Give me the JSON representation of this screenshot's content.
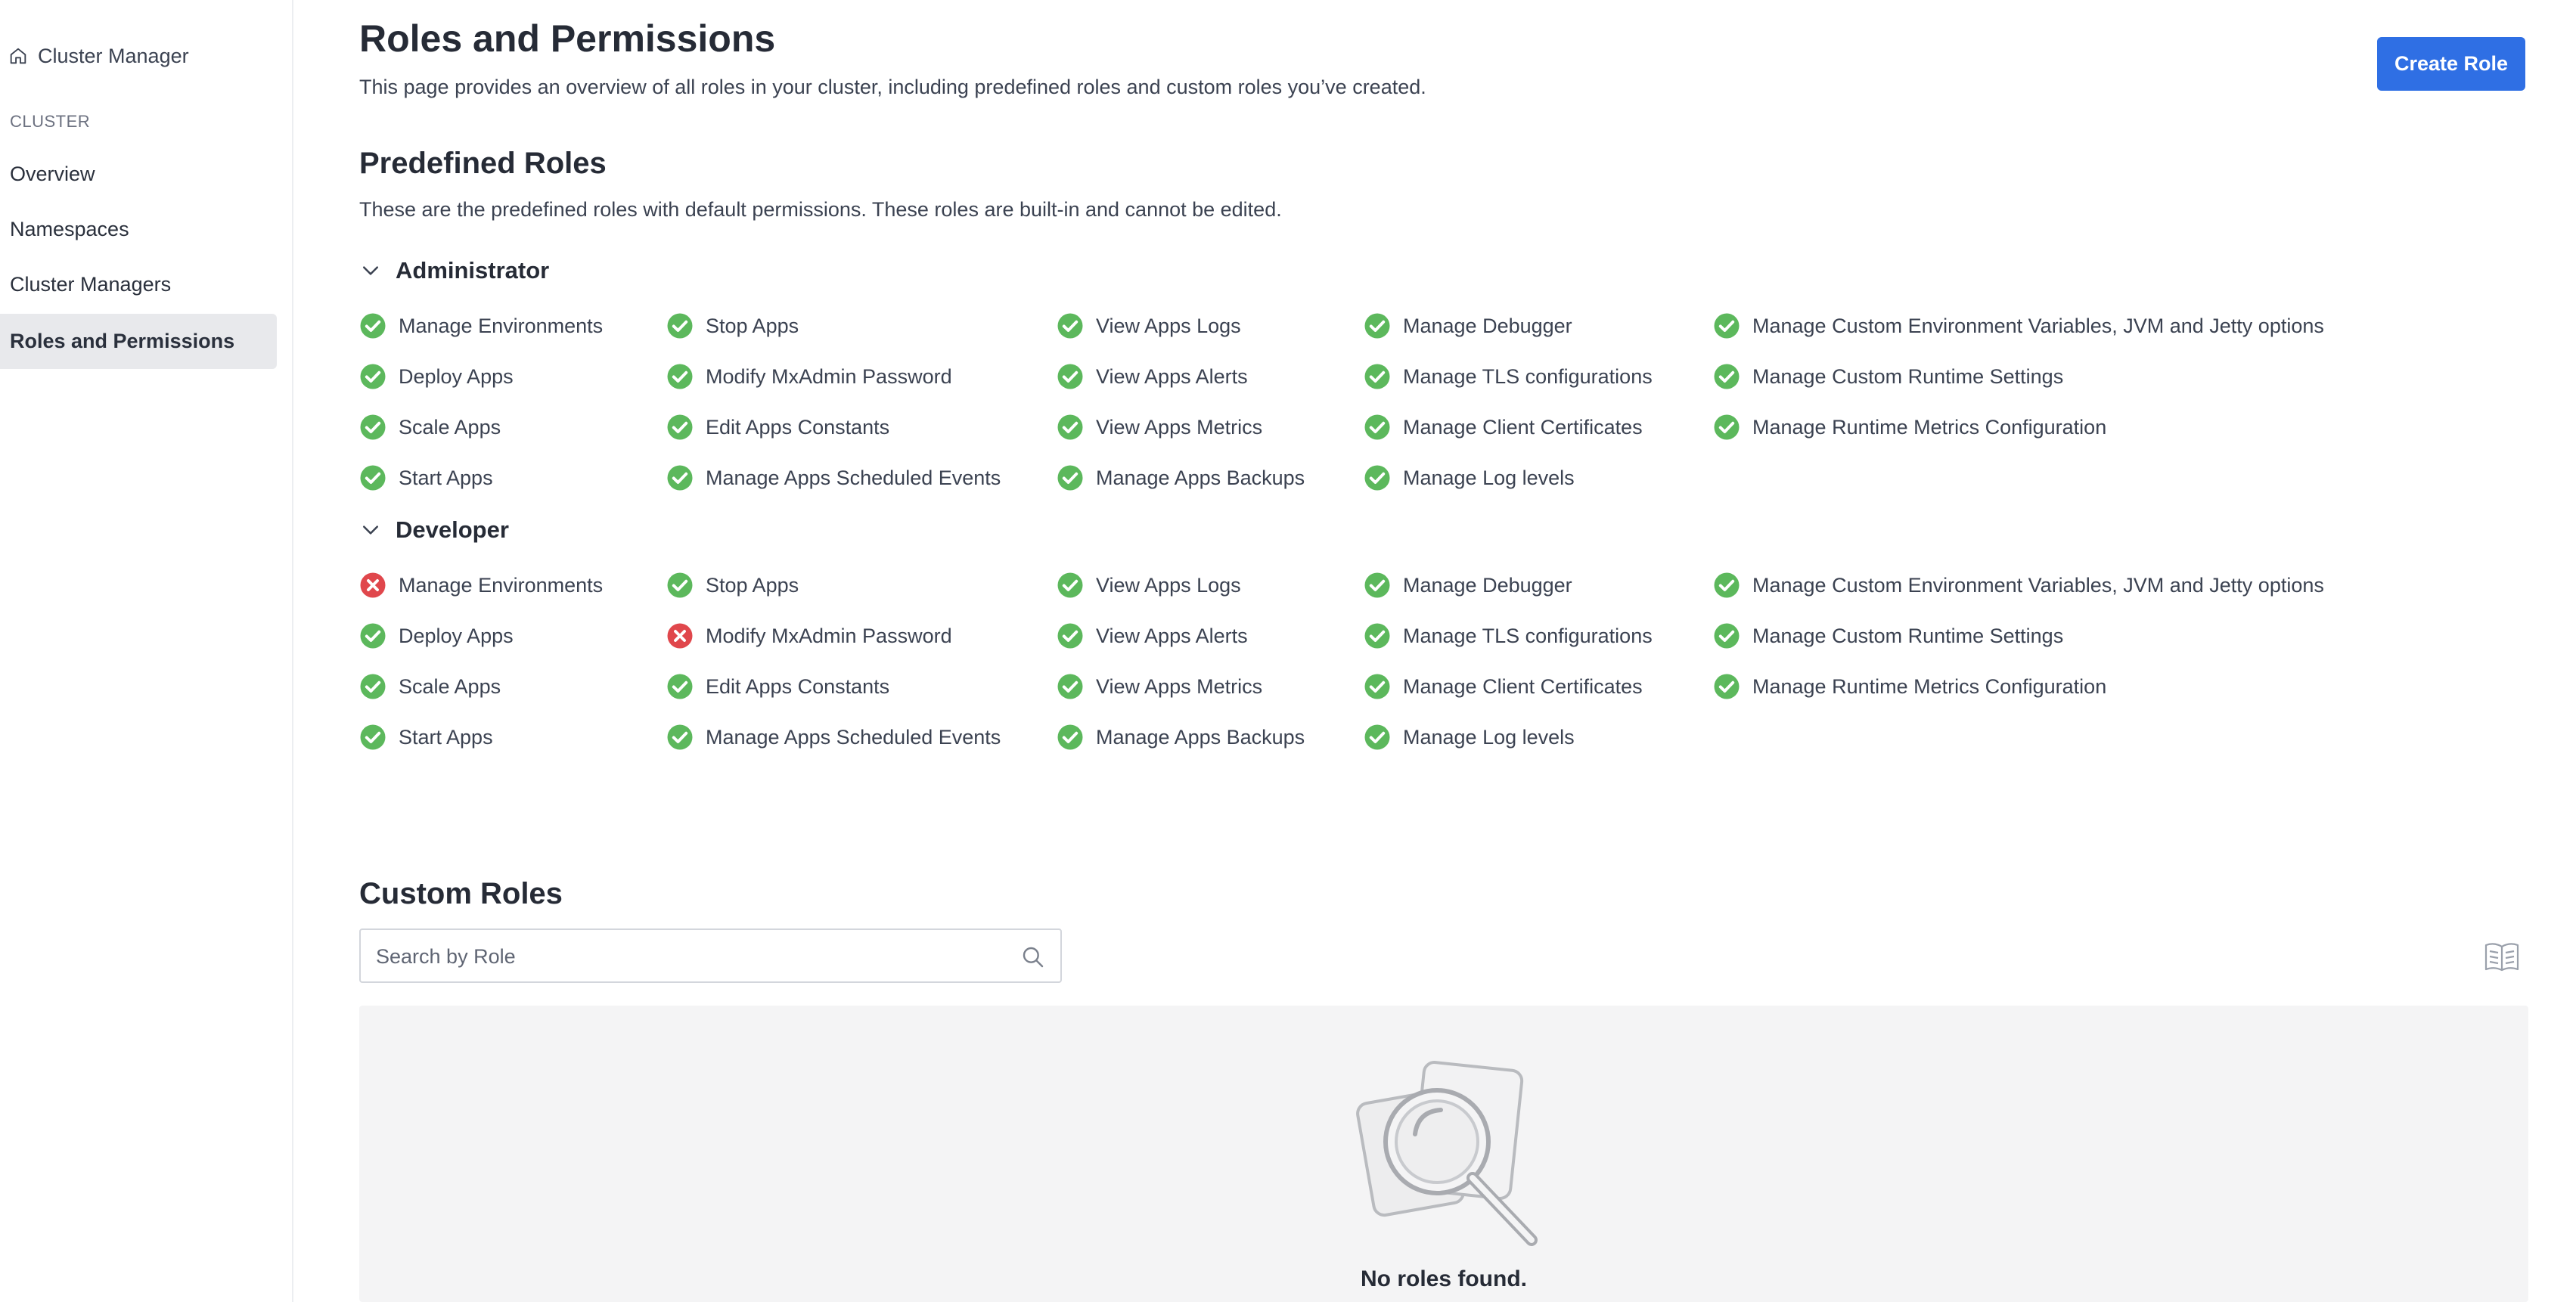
{
  "sidebar": {
    "brand": "Cluster Manager",
    "section_label": "CLUSTER",
    "items": [
      {
        "label": "Overview"
      },
      {
        "label": "Namespaces"
      },
      {
        "label": "Cluster Managers"
      },
      {
        "label": "Roles and Permissions",
        "active": true
      }
    ]
  },
  "header": {
    "title": "Roles and Permissions",
    "description": "This page provides an overview of all roles in your cluster, including predefined roles and custom roles you’ve created.",
    "create_button": "Create Role"
  },
  "predefined": {
    "title": "Predefined Roles",
    "description": "These are the predefined roles with default permissions. These roles are built-in and cannot be edited.",
    "roles": [
      {
        "name": "Administrator",
        "expanded": true,
        "permissions": [
          {
            "label": "Manage Environments",
            "granted": true
          },
          {
            "label": "Stop Apps",
            "granted": true
          },
          {
            "label": "View Apps Logs",
            "granted": true
          },
          {
            "label": "Manage Debugger",
            "granted": true
          },
          {
            "label": "Manage Custom Environment Variables, JVM and Jetty options",
            "granted": true
          },
          {
            "label": "Deploy Apps",
            "granted": true
          },
          {
            "label": "Modify MxAdmin Password",
            "granted": true
          },
          {
            "label": "View Apps Alerts",
            "granted": true
          },
          {
            "label": "Manage TLS configurations",
            "granted": true
          },
          {
            "label": "Manage Custom Runtime Settings",
            "granted": true
          },
          {
            "label": "Scale Apps",
            "granted": true
          },
          {
            "label": "Edit Apps Constants",
            "granted": true
          },
          {
            "label": "View Apps Metrics",
            "granted": true
          },
          {
            "label": "Manage Client Certificates",
            "granted": true
          },
          {
            "label": "Manage Runtime Metrics Configuration",
            "granted": true
          },
          {
            "label": "Start Apps",
            "granted": true
          },
          {
            "label": "Manage Apps Scheduled Events",
            "granted": true
          },
          {
            "label": "Manage Apps Backups",
            "granted": true
          },
          {
            "label": "Manage Log levels",
            "granted": true
          }
        ]
      },
      {
        "name": "Developer",
        "expanded": true,
        "permissions": [
          {
            "label": "Manage Environments",
            "granted": false
          },
          {
            "label": "Stop Apps",
            "granted": true
          },
          {
            "label": "View Apps Logs",
            "granted": true
          },
          {
            "label": "Manage Debugger",
            "granted": true
          },
          {
            "label": "Manage Custom Environment Variables, JVM and Jetty options",
            "granted": true
          },
          {
            "label": "Deploy Apps",
            "granted": true
          },
          {
            "label": "Modify MxAdmin Password",
            "granted": false
          },
          {
            "label": "View Apps Alerts",
            "granted": true
          },
          {
            "label": "Manage TLS configurations",
            "granted": true
          },
          {
            "label": "Manage Custom Runtime Settings",
            "granted": true
          },
          {
            "label": "Scale Apps",
            "granted": true
          },
          {
            "label": "Edit Apps Constants",
            "granted": true
          },
          {
            "label": "View Apps Metrics",
            "granted": true
          },
          {
            "label": "Manage Client Certificates",
            "granted": true
          },
          {
            "label": "Manage Runtime Metrics Configuration",
            "granted": true
          },
          {
            "label": "Start Apps",
            "granted": true
          },
          {
            "label": "Manage Apps Scheduled Events",
            "granted": true
          },
          {
            "label": "Manage Apps Backups",
            "granted": true
          },
          {
            "label": "Manage Log levels",
            "granted": true
          }
        ]
      }
    ]
  },
  "custom": {
    "title": "Custom Roles",
    "search_placeholder": "Search by Role",
    "search_value": "",
    "empty_text": "No roles found."
  },
  "colors": {
    "accent": "#2f6fe4",
    "granted": "#5cb85c",
    "denied": "#e0474c",
    "active_nav_bg": "#e8e9ec"
  },
  "icons": {
    "brand": "home-icon",
    "search": "search-icon",
    "docs": "book-icon",
    "granted": "check-circle-icon",
    "denied": "x-circle-icon",
    "expand": "chevron-down-icon"
  }
}
